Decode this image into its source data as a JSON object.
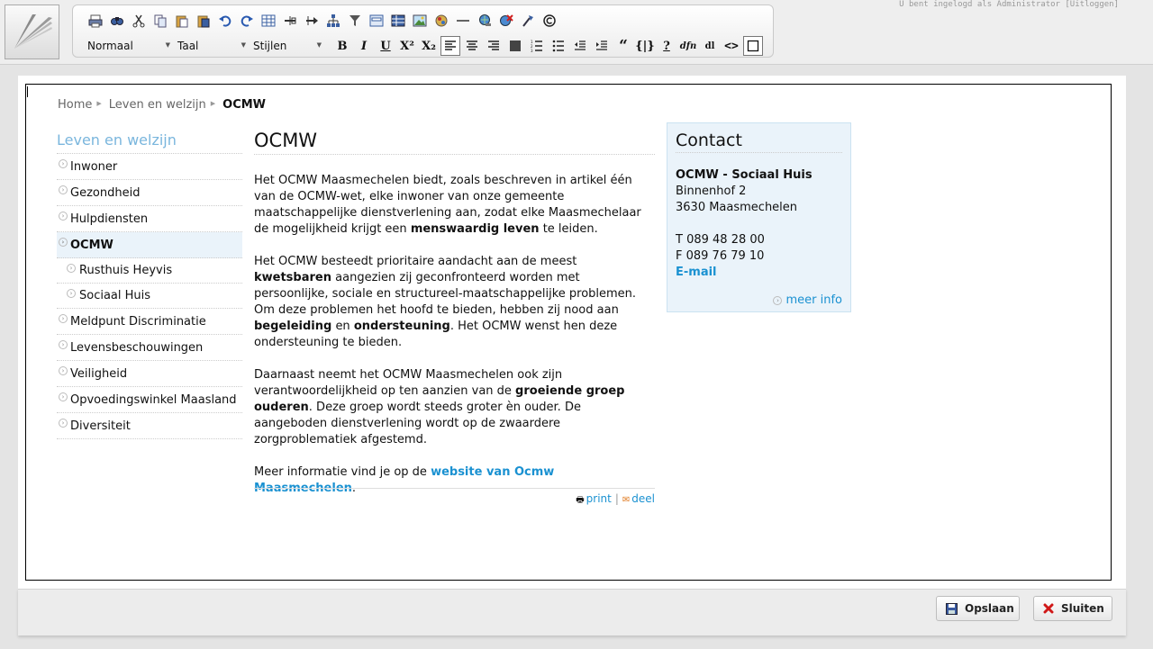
{
  "header": {
    "user_text": "U bent ingelogd als Administrator",
    "logout_label": "[Uitloggen]"
  },
  "toolbar": {
    "row1_icons": [
      "print-icon",
      "find-icon",
      "cut-icon",
      "copy-icon",
      "paste-icon",
      "paste-word-icon",
      "undo-icon",
      "redo-icon",
      "table-icon",
      "insert-row-icon",
      "insert-column-icon",
      "sitemap-icon",
      "filter-icon",
      "form-icon",
      "grid-icon",
      "image-icon",
      "media-icon",
      "horizontal-rule-icon",
      "link-icon",
      "unlink-icon",
      "anchor-icon",
      "copyright-icon"
    ],
    "format_select": "Normaal",
    "language_select": "Taal",
    "styles_select": "Stijlen",
    "bold": "B",
    "italic": "I",
    "underline": "U",
    "superscript": "X²",
    "subscript": "X₂",
    "quote": "“",
    "code": "{|}",
    "abbr": "?",
    "dfn": "dfn",
    "dl": "dl",
    "source": "<>"
  },
  "breadcrumb": {
    "home": "Home",
    "parent": "Leven en welzijn",
    "current": "OCMW"
  },
  "sidebar": {
    "title": "Leven en welzijn",
    "items": [
      {
        "label": "Inwoner"
      },
      {
        "label": "Gezondheid"
      },
      {
        "label": "Hulpdiensten"
      },
      {
        "label": "OCMW"
      },
      {
        "label": "Rusthuis Heyvis"
      },
      {
        "label": "Sociaal Huis"
      },
      {
        "label": "Meldpunt Discriminatie"
      },
      {
        "label": "Levensbeschouwingen"
      },
      {
        "label": "Veiligheid"
      },
      {
        "label": "Opvoedingswinkel Maasland"
      },
      {
        "label": "Diversiteit"
      }
    ]
  },
  "article": {
    "title": "OCMW",
    "p1_a": "Het OCMW Maasmechelen biedt, zoals beschreven in artikel één van de OCMW-wet, elke inwoner van onze gemeente maatschappelijke dienstverlening aan, zodat elke Maasmechelaar de mogelijkheid krijgt een",
    "p1_b": "menswaardig leven",
    "p1_c": "te leiden.",
    "p2_a": "Het OCMW besteedt prioritaire aandacht aan de meest",
    "p2_b": "kwetsbaren",
    "p2_c": "aangezien zij geconfronteerd worden met persoonlijke, sociale en structureel-maatschappelijke problemen.  Om deze problemen het hoofd te bieden, hebben zij nood aan",
    "p2_d": "begeleiding",
    "p2_e": "en",
    "p2_f": "ondersteuning",
    "p2_g": ".  Het OCMW wenst hen deze ondersteuning te bieden.",
    "p3_a": "Daarnaast neemt het OCMW Maasmechelen ook zijn verantwoordelijkheid op ten aanzien van de",
    "p3_b": "groeiende groep ouderen",
    "p3_c": ".  Deze groep wordt steeds groter èn ouder.  De aangeboden dienstverlening wordt op de zwaardere zorgproblematiek afgestemd.",
    "p4_a": "Meer informatie vind je op de",
    "p4_link": "website van Ocmw Maasmechelen",
    "p4_c": ".",
    "print_label": "print",
    "share_label": "deel"
  },
  "contact": {
    "title": "Contact",
    "name": "OCMW - Sociaal Huis",
    "street": "Binnenhof 2",
    "city": "3630 Maasmechelen",
    "phone": "T 089 48 28 00",
    "fax": "F 089 76 79 10",
    "email_label": "E-mail",
    "more_label": "meer info"
  },
  "footer": {
    "save_label": "Opslaan",
    "close_label": "Sluiten"
  },
  "colors": {
    "link": "#1a91d1",
    "sidebar_title": "#7ab6dd",
    "active_bg": "#eaf3fa"
  }
}
